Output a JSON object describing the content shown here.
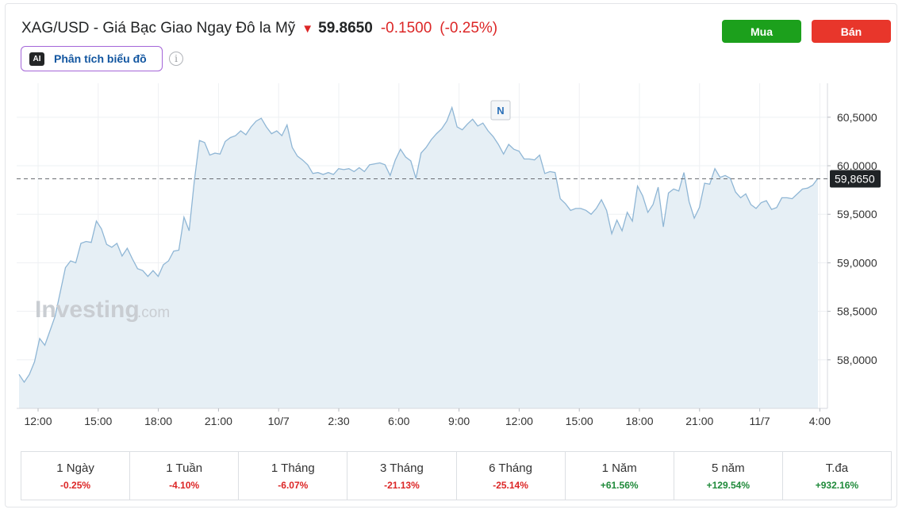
{
  "header": {
    "title": "XAG/USD - Giá Bạc Giao Ngay Đô la Mỹ",
    "price": "59.8650",
    "change": "-0.1500",
    "change_pct": "(-0.25%)",
    "direction_icon": "arrow-down-icon"
  },
  "actions": {
    "buy_label": "Mua",
    "sell_label": "Bán"
  },
  "ai": {
    "badge": "AI",
    "label": "Phân tích biểu đồ",
    "info_icon": "i"
  },
  "chart_data": {
    "type": "area",
    "watermark": "Investing",
    "watermark_suffix": ".com",
    "current_price_label": "59,8650",
    "current_price": 59.865,
    "marker_label": "N",
    "ylim": [
      57.5,
      60.85
    ],
    "y_ticks": [
      {
        "value": 58.0,
        "label": "58,0000"
      },
      {
        "value": 58.5,
        "label": "58,5000"
      },
      {
        "value": 59.0,
        "label": "59,0000"
      },
      {
        "value": 59.5,
        "label": "59,5000"
      },
      {
        "value": 60.0,
        "label": "60,0000"
      },
      {
        "value": 60.5,
        "label": "60,5000"
      }
    ],
    "x_ticks": [
      "12:00",
      "15:00",
      "18:00",
      "21:00",
      "10/7",
      "2:30",
      "6:00",
      "9:00",
      "12:00",
      "15:00",
      "18:00",
      "21:00",
      "11/7",
      "4:00"
    ],
    "series": [
      {
        "values": [
          57.85,
          57.77,
          57.85,
          57.98,
          58.22,
          58.15,
          58.3,
          58.45,
          58.7,
          58.95,
          59.02,
          59.0,
          59.2,
          59.22,
          59.21,
          59.43,
          59.35,
          59.19,
          59.16,
          59.2,
          59.07,
          59.15,
          59.04,
          58.94,
          58.92,
          58.86,
          58.92,
          58.86,
          58.98,
          59.02,
          59.12,
          59.13,
          59.47,
          59.33,
          59.84,
          60.26,
          60.24,
          60.11,
          60.13,
          60.12,
          60.25,
          60.29,
          60.31,
          60.36,
          60.32,
          60.4,
          60.46,
          60.49,
          60.4,
          60.33,
          60.36,
          60.31,
          60.42,
          60.19,
          60.1,
          60.06,
          60.01,
          59.92,
          59.93,
          59.91,
          59.93,
          59.91,
          59.97,
          59.96,
          59.97,
          59.94,
          59.98,
          59.94,
          60.01,
          60.02,
          60.03,
          60.01,
          59.9,
          60.06,
          60.17,
          60.09,
          60.05,
          59.87,
          60.13,
          60.19,
          60.27,
          60.33,
          60.38,
          60.46,
          60.6,
          60.4,
          60.37,
          60.43,
          60.48,
          60.41,
          60.44,
          60.36,
          60.3,
          60.22,
          60.12,
          60.22,
          60.17,
          60.15,
          60.07,
          60.07,
          60.06,
          60.11,
          59.92,
          59.94,
          59.93,
          59.66,
          59.61,
          59.54,
          59.56,
          59.56,
          59.54,
          59.5,
          59.56,
          59.65,
          59.54,
          59.3,
          59.44,
          59.33,
          59.52,
          59.43,
          59.79,
          59.69,
          59.52,
          59.6,
          59.78,
          59.37,
          59.72,
          59.76,
          59.74,
          59.93,
          59.63,
          59.46,
          59.57,
          59.82,
          59.81,
          59.97,
          59.88,
          59.9,
          59.87,
          59.73,
          59.67,
          59.71,
          59.6,
          59.56,
          59.62,
          59.64,
          59.55,
          59.57,
          59.67,
          59.67,
          59.66,
          59.71,
          59.76,
          59.77,
          59.8,
          59.87
        ]
      }
    ],
    "grid": true,
    "line_color": "#8fb6d5",
    "fill_color": "#e6eff5"
  },
  "performance": [
    {
      "label": "1 Ngày",
      "value": "-0.25%",
      "sign": "neg"
    },
    {
      "label": "1 Tuần",
      "value": "-4.10%",
      "sign": "neg"
    },
    {
      "label": "1 Tháng",
      "value": "-6.07%",
      "sign": "neg"
    },
    {
      "label": "3 Tháng",
      "value": "-21.13%",
      "sign": "neg"
    },
    {
      "label": "6 Tháng",
      "value": "-25.14%",
      "sign": "neg"
    },
    {
      "label": "1 Năm",
      "value": "+61.56%",
      "sign": "pos"
    },
    {
      "label": "5 năm",
      "value": "+129.54%",
      "sign": "pos"
    },
    {
      "label": "T.đa",
      "value": "+932.16%",
      "sign": "pos"
    }
  ]
}
